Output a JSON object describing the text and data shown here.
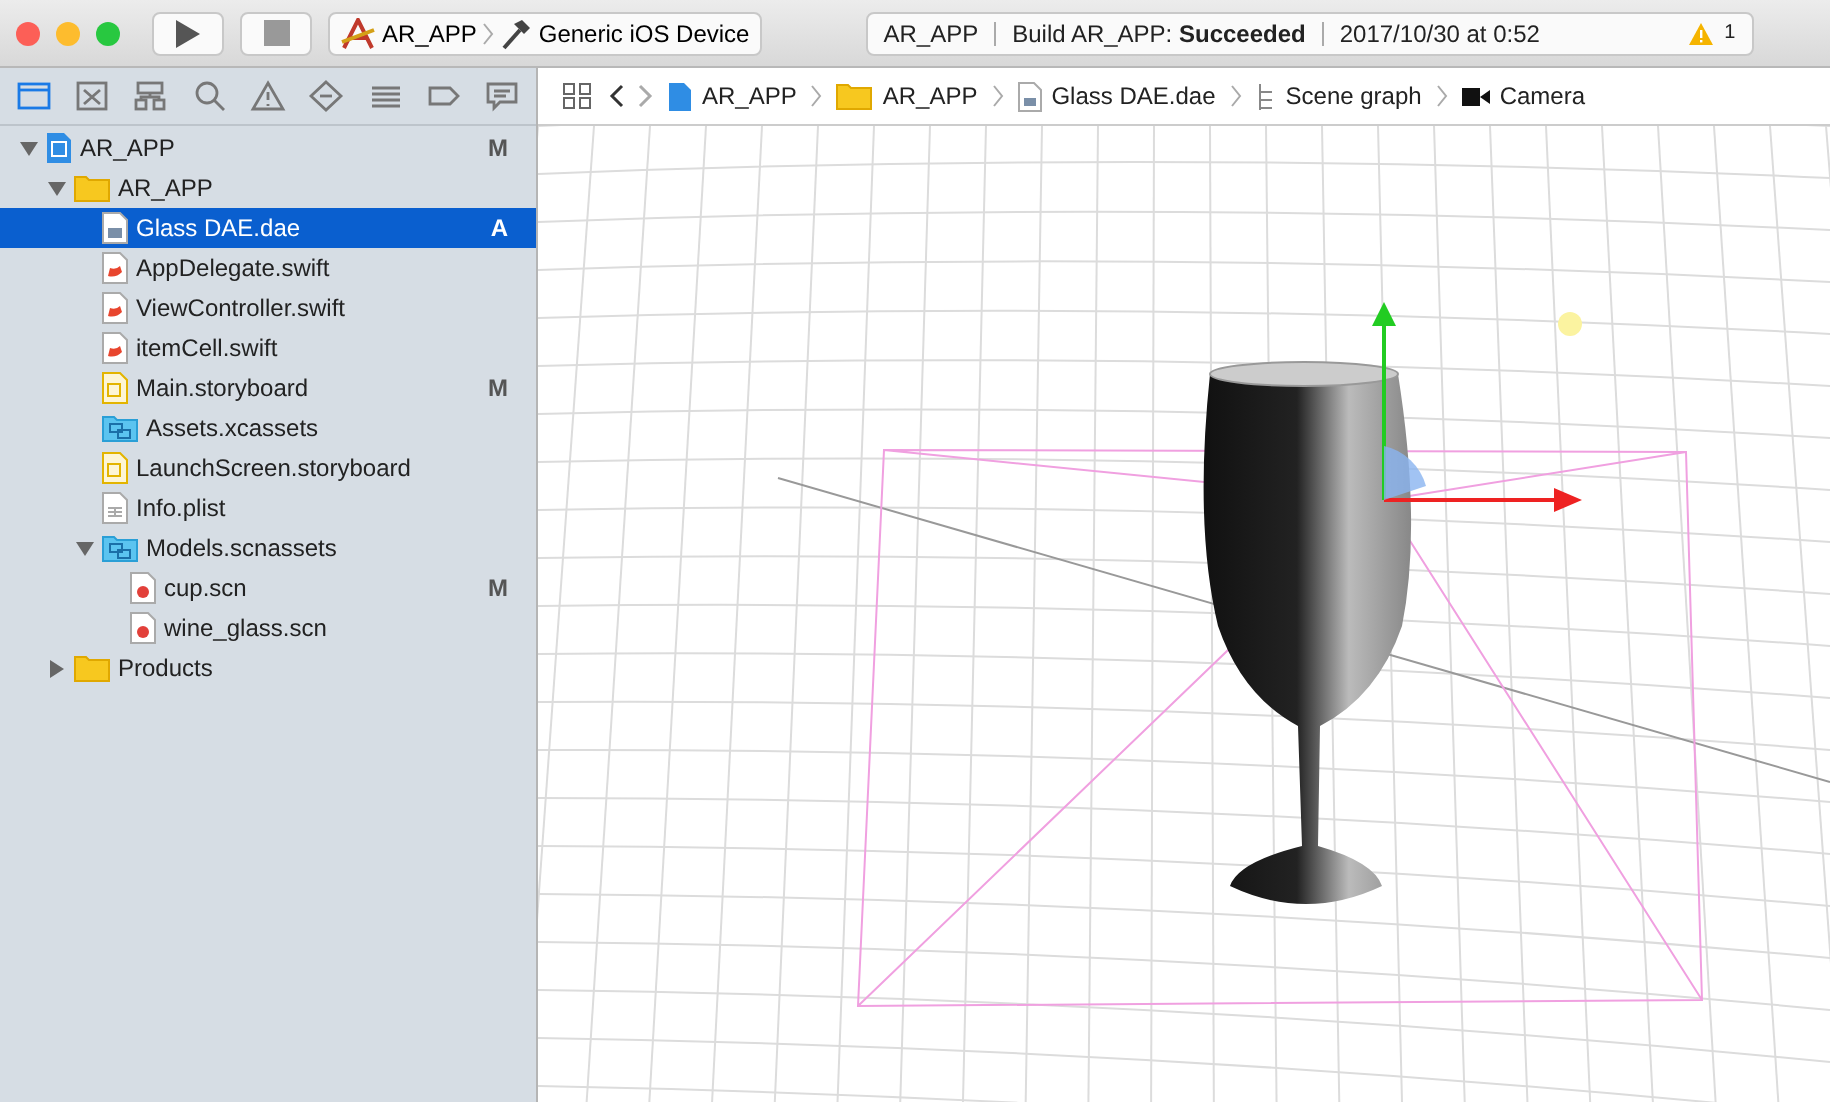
{
  "window": {
    "scheme": {
      "project": "AR_APP",
      "device": "Generic iOS Device"
    },
    "activity": {
      "project": "AR_APP",
      "status": "Build AR_APP: **Succeeded**",
      "time": "2017/10/30 at 0:52",
      "warnings": "1"
    }
  },
  "navigator_tabs": [
    {
      "kind": "folder",
      "selected": true
    },
    {
      "kind": "box",
      "selected": false
    },
    {
      "kind": "hierarchy",
      "selected": false
    },
    {
      "kind": "search",
      "selected": false
    },
    {
      "kind": "warning",
      "selected": false
    },
    {
      "kind": "diamond",
      "selected": false
    },
    {
      "kind": "list",
      "selected": false
    },
    {
      "kind": "tag",
      "selected": false
    },
    {
      "kind": "comment",
      "selected": false
    }
  ],
  "tree": [
    {
      "name": "AR_APP",
      "kind": "project",
      "badge": "M",
      "selected": false,
      "expanded": true,
      "children": [
        {
          "name": "AR_APP",
          "kind": "folder",
          "selected": false,
          "expanded": true,
          "children": [
            {
              "name": "Glass DAE.dae",
              "kind": "dae",
              "badge": "A",
              "selected": true
            },
            {
              "name": "AppDelegate.swift",
              "kind": "swift",
              "selected": false
            },
            {
              "name": "ViewController.swift",
              "kind": "swift",
              "selected": false
            },
            {
              "name": "itemCell.swift",
              "kind": "swift",
              "selected": false
            },
            {
              "name": "Main.storyboard",
              "kind": "storyboard",
              "badge": "M",
              "selected": false
            },
            {
              "name": "Assets.xcassets",
              "kind": "assets",
              "selected": false
            },
            {
              "name": "LaunchScreen.storyboard",
              "kind": "storyboard",
              "selected": false
            },
            {
              "name": "Info.plist",
              "kind": "plist",
              "selected": false
            },
            {
              "name": "Models.scnassets",
              "kind": "assets",
              "selected": false,
              "expanded": true,
              "children": [
                {
                  "name": "cup.scn",
                  "kind": "scn",
                  "badge": "M",
                  "selected": false
                },
                {
                  "name": "wine_glass.scn",
                  "kind": "scn",
                  "selected": false
                }
              ]
            }
          ]
        },
        {
          "name": "Products",
          "kind": "folder",
          "selected": false,
          "expanded": false
        }
      ]
    }
  ],
  "jump_bar": [
    {
      "label": "AR_APP",
      "kind": "project"
    },
    {
      "label": "AR_APP",
      "kind": "folder"
    },
    {
      "label": "Glass DAE.dae",
      "kind": "dae"
    },
    {
      "label": "Scene graph",
      "kind": "graph"
    },
    {
      "label": "Camera",
      "kind": "camera"
    }
  ]
}
